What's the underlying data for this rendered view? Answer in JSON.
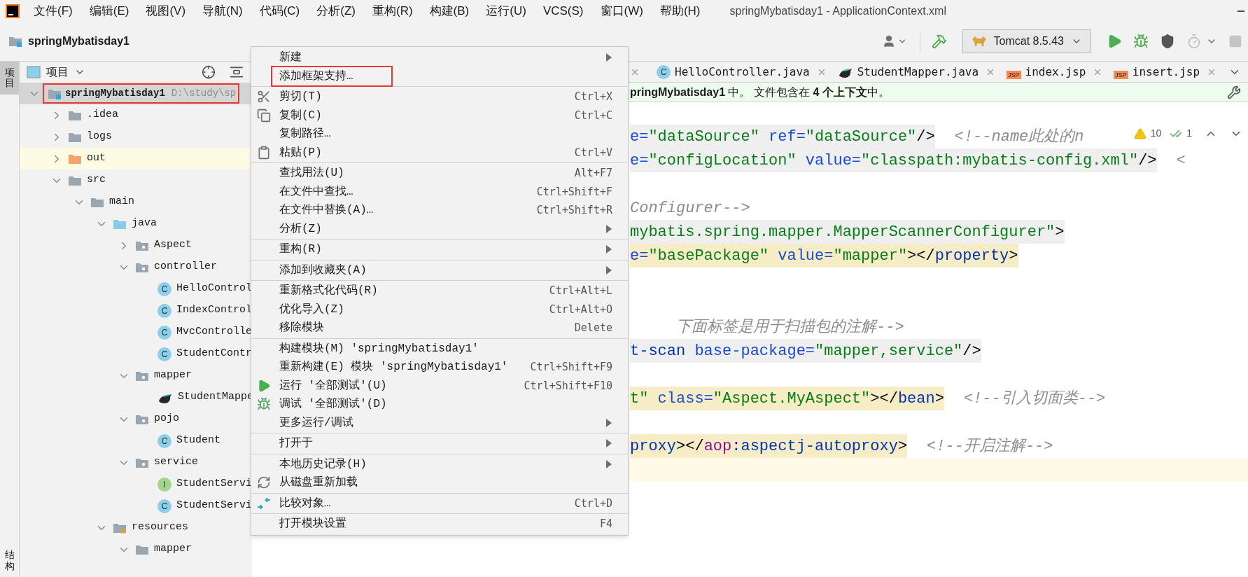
{
  "window": {
    "title": "springMybatisday1 - ApplicationContext.xml"
  },
  "menu_bar": [
    "文件(F)",
    "编辑(E)",
    "视图(V)",
    "导航(N)",
    "代码(C)",
    "分析(Z)",
    "重构(R)",
    "构建(B)",
    "运行(U)",
    "VCS(S)",
    "窗口(W)",
    "帮助(H)"
  ],
  "toolbar": {
    "project": "springMybatisday1",
    "run_config": "Tomcat 8.5.43"
  },
  "side_tabs": [
    {
      "label": "项目",
      "selected": true
    },
    {
      "label": "结构",
      "selected": false
    }
  ],
  "project_panel": {
    "title": "项目",
    "tree": [
      {
        "label": "springMybatisday1",
        "path": "D:\\study\\sp",
        "kind": "module",
        "expanded": true,
        "selected": true,
        "marked": true,
        "children": [
          {
            "label": ".idea",
            "kind": "folder",
            "expanded": false,
            "selected": false
          },
          {
            "label": "logs",
            "kind": "folder",
            "expanded": false,
            "selected": false
          },
          {
            "label": "out",
            "kind": "excluded",
            "expanded": false,
            "selected": false
          },
          {
            "label": "src",
            "kind": "folder",
            "expanded": true,
            "selected": false,
            "children": [
              {
                "label": "main",
                "kind": "folder",
                "expanded": true,
                "selected": false,
                "children": [
                  {
                    "label": "java",
                    "kind": "source-root",
                    "expanded": true,
                    "selected": false,
                    "children": [
                      {
                        "label": "Aspect",
                        "kind": "package",
                        "expanded": false,
                        "selected": false
                      },
                      {
                        "label": "controller",
                        "kind": "package",
                        "expanded": true,
                        "selected": false,
                        "children": [
                          {
                            "label": "HelloControl",
                            "kind": "class",
                            "badge": "C",
                            "selected": false
                          },
                          {
                            "label": "IndexControl",
                            "kind": "class",
                            "badge": "C",
                            "selected": false
                          },
                          {
                            "label": "MvcControlle",
                            "kind": "class",
                            "badge": "C",
                            "selected": false
                          },
                          {
                            "label": "StudentContr",
                            "kind": "class",
                            "badge": "C",
                            "selected": false
                          }
                        ]
                      },
                      {
                        "label": "mapper",
                        "kind": "package",
                        "expanded": true,
                        "selected": false,
                        "children": [
                          {
                            "label": "StudentMappe",
                            "kind": "mapper",
                            "selected": false
                          }
                        ]
                      },
                      {
                        "label": "pojo",
                        "kind": "package",
                        "expanded": true,
                        "selected": false,
                        "children": [
                          {
                            "label": "Student",
                            "kind": "class",
                            "badge": "C",
                            "selected": false
                          }
                        ]
                      },
                      {
                        "label": "service",
                        "kind": "package",
                        "expanded": true,
                        "selected": false,
                        "children": [
                          {
                            "label": "StudentServi",
                            "kind": "interface",
                            "badge": "I",
                            "selected": false
                          },
                          {
                            "label": "StudentServi",
                            "kind": "class",
                            "badge": "C",
                            "selected": false
                          }
                        ]
                      }
                    ]
                  },
                  {
                    "label": "resources",
                    "kind": "resources-root",
                    "expanded": true,
                    "selected": false,
                    "children": [
                      {
                        "label": "mapper",
                        "kind": "folder",
                        "expanded": true,
                        "selected": false
                      }
                    ]
                  }
                ]
              }
            ]
          }
        ]
      }
    ]
  },
  "editor_tabs": [
    {
      "label": "HelloController.java",
      "kind": "class",
      "badge": "C"
    },
    {
      "label": "StudentMapper.java",
      "kind": "mapper"
    },
    {
      "label": "index.jsp",
      "kind": "jsp",
      "badge": "JSP"
    },
    {
      "label": "insert.jsp",
      "kind": "jsp",
      "badge": "JSP"
    }
  ],
  "notification": "**pringMybatisday1** 中。 文件包含在 **4 个上下文**中。",
  "inspections": {
    "warnings": "10",
    "passed": "1"
  },
  "code_lines": [
    {
      "kind": "tag",
      "code": [
        {
          "kind": "attr",
          "t": "e="
        },
        {
          "kind": "str",
          "t": "\"dataSource\""
        },
        {
          "kind": "attr",
          "t": " ref="
        },
        {
          "kind": "str",
          "t": "\"dataSource\""
        },
        {
          "kind": "plain",
          "t": "/>"
        }
      ],
      "after": "<!--name此处的n"
    },
    {
      "kind": "tag",
      "code": [
        {
          "kind": "attr",
          "t": "e="
        },
        {
          "kind": "str",
          "t": "\"configLocation\""
        },
        {
          "kind": "attr",
          "t": " value="
        },
        {
          "kind": "str",
          "t": "\"classpath:mybatis-config.xml\""
        },
        {
          "kind": "plain",
          "t": "/>"
        }
      ],
      "after": "<"
    },
    {
      "kind": "blank"
    },
    {
      "kind": "plain",
      "code": [
        {
          "kind": "comment",
          "t": "Configurer-->"
        }
      ]
    },
    {
      "kind": "tag",
      "code": [
        {
          "kind": "str",
          "t": "mybatis.spring.mapper.MapperScannerConfigurer\""
        },
        {
          "kind": "plain",
          "t": ">"
        }
      ]
    },
    {
      "kind": "match",
      "code": [
        {
          "kind": "attr",
          "t": "e="
        },
        {
          "kind": "str",
          "t": "\"basePackage\""
        },
        {
          "kind": "attr",
          "t": " value="
        },
        {
          "kind": "str",
          "t": "\"mapper\""
        },
        {
          "kind": "plain",
          "t": "></"
        },
        {
          "kind": "tag",
          "t": "property"
        },
        {
          "kind": "plain",
          "t": ">"
        }
      ]
    },
    {
      "kind": "blank"
    },
    {
      "kind": "blank"
    },
    {
      "kind": "plain",
      "code": [
        {
          "kind": "comment",
          "t": "     下面标签是用于扫描包的注解-->"
        }
      ]
    },
    {
      "kind": "tag",
      "code": [
        {
          "kind": "tag",
          "t": "t-scan"
        },
        {
          "kind": "attr",
          "t": " base-package="
        },
        {
          "kind": "str",
          "t": "\"mapper,service\""
        },
        {
          "kind": "plain",
          "t": "/>"
        }
      ]
    },
    {
      "kind": "blank"
    },
    {
      "kind": "match",
      "code": [
        {
          "kind": "str",
          "t": "t\""
        },
        {
          "kind": "attr",
          "t": " class="
        },
        {
          "kind": "str",
          "t": "\"Aspect.MyAspect\""
        },
        {
          "kind": "plain",
          "t": "></"
        },
        {
          "kind": "tag",
          "t": "bean"
        },
        {
          "kind": "plain",
          "t": ">"
        }
      ],
      "after": "<!--引入切面类-->"
    },
    {
      "kind": "blank"
    },
    {
      "kind": "match",
      "code": [
        {
          "kind": "tag",
          "t": "proxy"
        },
        {
          "kind": "plain",
          "t": "></"
        },
        {
          "kind": "ns",
          "t": "aop"
        },
        {
          "kind": "tag",
          "t": ":aspectj-autoproxy"
        },
        {
          "kind": "plain",
          "t": ">"
        }
      ],
      "after": "<!--开启注解-->"
    },
    {
      "kind": "current"
    }
  ],
  "context_menu": {
    "groups": [
      [
        {
          "label": "新建",
          "kind": "text",
          "submenu": true,
          "marked": false
        },
        {
          "label": "添加框架支持…",
          "kind": "text",
          "submenu": false,
          "marked": true
        }
      ],
      [
        {
          "label": "剪切(T)",
          "shortcut": "Ctrl+X",
          "kind": "cut",
          "submenu": false,
          "marked": false
        },
        {
          "label": "复制(C)",
          "shortcut": "Ctrl+C",
          "kind": "copy",
          "submenu": false,
          "marked": false
        },
        {
          "label": "复制路径…",
          "kind": "text",
          "submenu": false,
          "marked": false
        },
        {
          "label": "粘贴(P)",
          "shortcut": "Ctrl+V",
          "kind": "paste",
          "submenu": false,
          "marked": false
        }
      ],
      [
        {
          "label": "查找用法(U)",
          "shortcut": "Alt+F7",
          "kind": "text",
          "submenu": false,
          "marked": false
        },
        {
          "label": "在文件中查找…",
          "shortcut": "Ctrl+Shift+F",
          "kind": "text",
          "submenu": false,
          "marked": false
        },
        {
          "label": "在文件中替换(A)…",
          "shortcut": "Ctrl+Shift+R",
          "kind": "text",
          "submenu": false,
          "marked": false
        },
        {
          "label": "分析(Z)",
          "kind": "text",
          "submenu": true,
          "marked": false
        }
      ],
      [
        {
          "label": "重构(R)",
          "kind": "text",
          "submenu": true,
          "marked": false
        }
      ],
      [
        {
          "label": "添加到收藏夹(A)",
          "kind": "text",
          "submenu": true,
          "marked": false
        }
      ],
      [
        {
          "label": "重新格式化代码(R)",
          "shortcut": "Ctrl+Alt+L",
          "kind": "text",
          "submenu": false,
          "marked": false
        },
        {
          "label": "优化导入(Z)",
          "shortcut": "Ctrl+Alt+O",
          "kind": "text",
          "submenu": false,
          "marked": false
        },
        {
          "label": "移除模块",
          "shortcut": "Delete",
          "kind": "text",
          "submenu": false,
          "marked": false
        }
      ],
      [
        {
          "label": "构建模块(M) 'springMybatisday1'",
          "kind": "text",
          "submenu": false,
          "marked": false
        },
        {
          "label": "重新构建(E) 模块 'springMybatisday1'",
          "shortcut": "Ctrl+Shift+F9",
          "kind": "text",
          "submenu": false,
          "marked": false
        },
        {
          "label": "运行 '全部测试'(U)",
          "shortcut": "Ctrl+Shift+F10",
          "kind": "run",
          "submenu": false,
          "marked": false
        },
        {
          "label": "调试 '全部测试'(D)",
          "kind": "debug",
          "submenu": false,
          "marked": false
        },
        {
          "label": "更多运行/调试",
          "kind": "text",
          "submenu": true,
          "marked": false
        }
      ],
      [
        {
          "label": "打开于",
          "kind": "text",
          "submenu": true,
          "marked": false
        }
      ],
      [
        {
          "label": "本地历史记录(H)",
          "kind": "text",
          "submenu": true,
          "marked": false
        },
        {
          "label": "从磁盘重新加载",
          "kind": "reload",
          "submenu": false,
          "marked": false
        }
      ],
      [
        {
          "label": "比较对象…",
          "shortcut": "Ctrl+D",
          "kind": "compare",
          "submenu": false,
          "marked": false
        }
      ],
      [
        {
          "label": "打开模块设置",
          "shortcut": "F4",
          "kind": "text",
          "submenu": false,
          "marked": false
        }
      ]
    ]
  }
}
